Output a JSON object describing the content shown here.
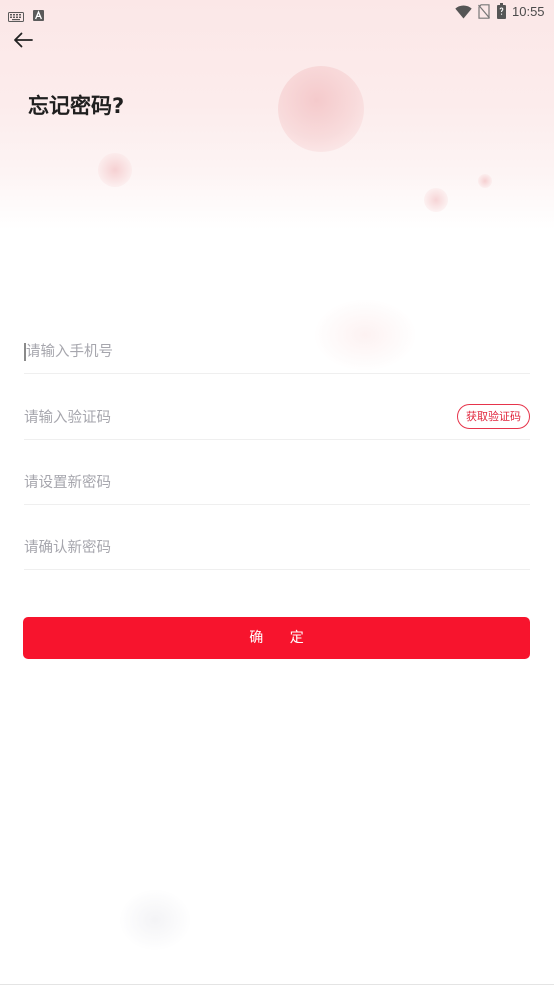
{
  "status_bar": {
    "time": "10:55",
    "icons": [
      "keyboard-icon",
      "a-notification-icon",
      "wifi-icon",
      "no-sim-icon",
      "battery-icon"
    ]
  },
  "header": {
    "back_icon": "arrow-left-icon",
    "title": "忘记密码?"
  },
  "form": {
    "phone": {
      "placeholder": "请输入手机号"
    },
    "code": {
      "placeholder": "请输入验证码"
    },
    "get_code_label": "获取验证码",
    "new_password": {
      "placeholder": "请设置新密码"
    },
    "confirm_password": {
      "placeholder": "请确认新密码"
    },
    "submit_label": "确 定"
  },
  "colors": {
    "accent": "#f7142d",
    "get_code_text": "#e0263d",
    "placeholder": "#a6a6ad",
    "divider": "#efefef",
    "header_background": "#fbe7e7"
  }
}
